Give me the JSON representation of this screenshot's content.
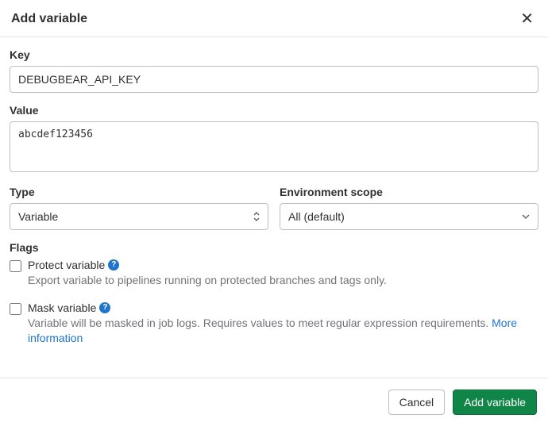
{
  "header": {
    "title": "Add variable"
  },
  "form": {
    "key_label": "Key",
    "key_value": "DEBUGBEAR_API_KEY",
    "value_label": "Value",
    "value_value": "abcdef123456",
    "type_label": "Type",
    "type_selected": "Variable",
    "scope_label": "Environment scope",
    "scope_selected": "All (default)",
    "flags_label": "Flags",
    "protect": {
      "title": "Protect variable",
      "desc": "Export variable to pipelines running on protected branches and tags only."
    },
    "mask": {
      "title": "Mask variable",
      "desc_prefix": "Variable will be masked in job logs. Requires values to meet regular expression requirements. ",
      "more_link": "More information"
    }
  },
  "footer": {
    "cancel": "Cancel",
    "submit": "Add variable"
  }
}
